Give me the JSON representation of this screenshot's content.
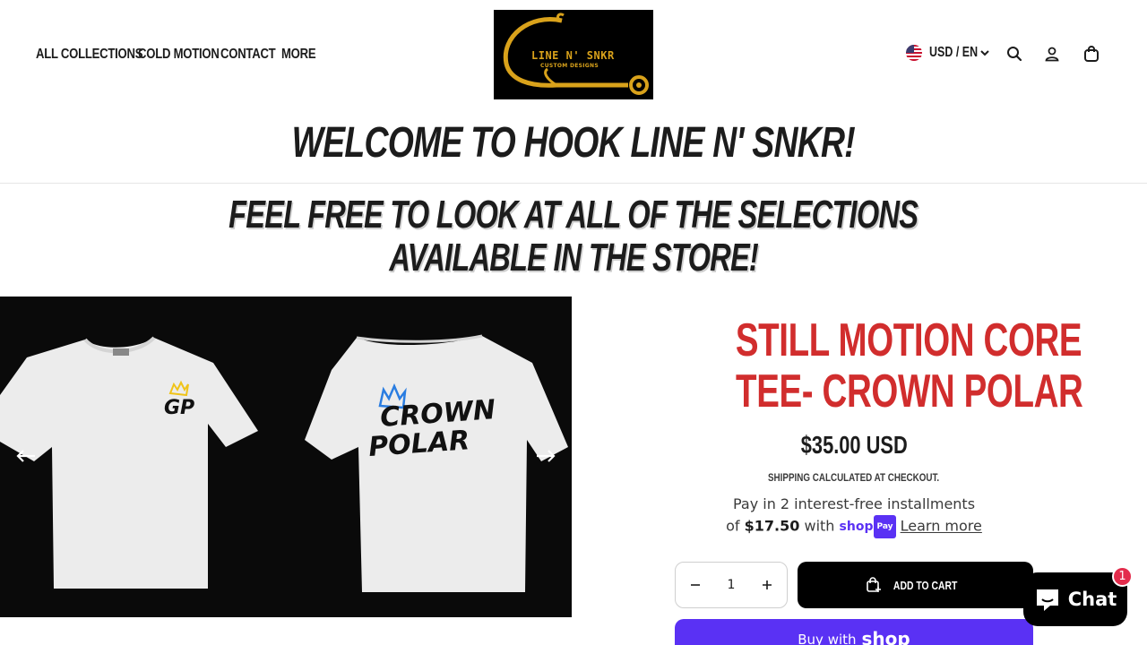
{
  "nav": {
    "items": [
      {
        "label": "ALL COLLECTIONS"
      },
      {
        "label": "COLD MOTION"
      },
      {
        "label": "CONTACT"
      },
      {
        "label": "MORE"
      }
    ]
  },
  "logo": {
    "title": "LINE N' SNKR",
    "subtitle": "CUSTOM DESIGNS"
  },
  "header": {
    "locale": "USD / EN",
    "icons": [
      "search-icon",
      "account-icon",
      "cart-icon"
    ]
  },
  "hero": {
    "welcome": "WELCOME TO HOOK LINE N' SNKR!",
    "subtitle_line1": "FEEL FREE TO LOOK AT ALL OF THE SELECTIONS",
    "subtitle_line2": "AVAILABLE IN THE STORE!"
  },
  "media": {
    "front_print": "GP",
    "back_print_line1": "CROWN",
    "back_print_line2": "POLAR"
  },
  "product": {
    "title_line1": "STILL MOTION CORE",
    "title_line2": "TEE- CROWN POLAR",
    "price": "$35.00 USD",
    "shipping_note": "SHIPPING CALCULATED AT CHECKOUT.",
    "installments_prefix": "Pay in 2 interest-free installments",
    "installments_of": "of",
    "installment_amount": "$17.50",
    "installments_with": "with",
    "shoppay_word": "shop",
    "shoppay_pay": "Pay",
    "learn_more": "Learn more",
    "quantity": "1",
    "add_to_cart": "ADD TO CART",
    "buy_with": "Buy with",
    "buy_brand": "shop"
  },
  "chat": {
    "label": "Chat",
    "badge": "1"
  },
  "colors": {
    "title_red": "#d12d2d",
    "shop_purple": "#5a31f4",
    "logo_gold": "#d9a21b",
    "badge_red": "#e32c4c"
  }
}
